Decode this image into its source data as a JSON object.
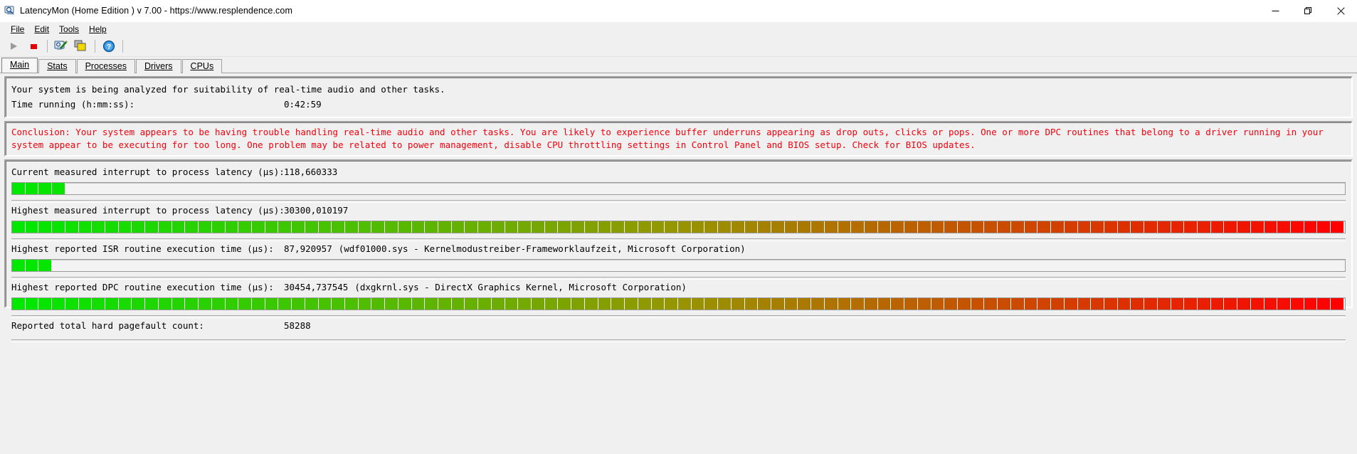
{
  "window": {
    "title": "LatencyMon  (Home Edition )  v 7.00 - https://www.resplendence.com",
    "app_icon": "latencymon-icon",
    "controls": {
      "minimize": "minimize-icon",
      "restore": "restore-icon",
      "close": "close-icon"
    }
  },
  "menu": {
    "items": [
      {
        "label": "File",
        "mnemonic": "F"
      },
      {
        "label": "Edit",
        "mnemonic": "E"
      },
      {
        "label": "Tools",
        "mnemonic": "T"
      },
      {
        "label": "Help",
        "mnemonic": "H"
      }
    ]
  },
  "toolbar": {
    "buttons": [
      {
        "name": "play-button",
        "icon": "play-icon",
        "enabled": false
      },
      {
        "name": "stop-button",
        "icon": "stop-icon",
        "enabled": true
      },
      {
        "name": "report-button",
        "icon": "report-icon",
        "enabled": true
      },
      {
        "name": "copy-button",
        "icon": "copy-icon",
        "enabled": true
      },
      {
        "name": "help-button",
        "icon": "help-icon",
        "enabled": true
      }
    ]
  },
  "tabs": [
    {
      "label": "Main",
      "mnemonic": "M",
      "active": true
    },
    {
      "label": "Stats",
      "mnemonic": "S",
      "active": false
    },
    {
      "label": "Processes",
      "mnemonic": "P",
      "active": false
    },
    {
      "label": "Drivers",
      "mnemonic": "D",
      "active": false
    },
    {
      "label": "CPUs",
      "mnemonic": "C",
      "active": false
    }
  ],
  "status_panel": {
    "analysis_text": "Your system is being analyzed for suitability of real-time audio and other tasks.",
    "time_running_label": "Time running (h:mm:ss):",
    "time_running_value": "0:42:59"
  },
  "conclusion_panel": {
    "text": "Conclusion: Your system appears to be having trouble handling real-time audio and other tasks. You are likely to experience buffer underruns appearing as drop outs, clicks or pops. One or more DPC routines that belong to a driver running in your system appear to be executing for too long. One problem may be related to power management, disable CPU throttling settings in Control Panel and BIOS setup. Check for BIOS updates.",
    "color": "#f4000c"
  },
  "metrics": [
    {
      "name": "current-interrupt-to-process-latency",
      "label": "Current measured interrupt to process latency (µs):",
      "value": "118,660333",
      "extra": "",
      "bar_percent": 3.3,
      "bar_segments": 4
    },
    {
      "name": "highest-interrupt-to-process-latency",
      "label": "Highest measured interrupt to process latency (µs):",
      "value": "30300,010197",
      "extra": "",
      "bar_percent": 100,
      "bar_segments": 100
    },
    {
      "name": "highest-isr-routine-execution-time",
      "label": "Highest reported ISR routine execution time (µs):",
      "value": "87,920957",
      "extra": "(wdf01000.sys - Kernelmodustreiber-Frameworklaufzeit, Microsoft Corporation)",
      "bar_percent": 2.5,
      "bar_segments": 3
    },
    {
      "name": "highest-dpc-routine-execution-time",
      "label": "Highest reported DPC routine execution time (µs):",
      "value": "30454,737545",
      "extra": "(dxgkrnl.sys - DirectX Graphics Kernel, Microsoft Corporation)",
      "bar_percent": 100,
      "bar_segments": 100
    },
    {
      "name": "reported-total-hard-pagefault-count",
      "label": "Reported total hard pagefault count:",
      "value": "58288",
      "extra": "",
      "bar_percent": 0,
      "bar_segments": 0
    }
  ],
  "colors": {
    "bar_start": "#00e800",
    "bar_mid": "#8a8a00",
    "bar_end": "#ff0000",
    "conclusion_red": "#f4000c",
    "window_bg": "#f0f0f0"
  }
}
